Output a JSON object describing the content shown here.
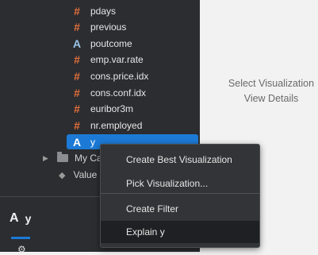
{
  "fields": [
    {
      "name": "pdays",
      "type": "numeric",
      "icon": "hash-icon"
    },
    {
      "name": "previous",
      "type": "numeric",
      "icon": "hash-icon"
    },
    {
      "name": "poutcome",
      "type": "string",
      "icon": "string-a-icon"
    },
    {
      "name": "emp.var.rate",
      "type": "numeric",
      "icon": "hash-icon"
    },
    {
      "name": "cons.price.idx",
      "type": "numeric",
      "icon": "hash-icon"
    },
    {
      "name": "cons.conf.idx",
      "type": "numeric",
      "icon": "hash-icon"
    },
    {
      "name": "euribor3m",
      "type": "numeric",
      "icon": "hash-icon"
    },
    {
      "name": "nr.employed",
      "type": "numeric",
      "icon": "hash-icon"
    },
    {
      "name": "y",
      "type": "string",
      "icon": "string-a-icon",
      "selected": true
    }
  ],
  "tree": {
    "my_calcs_label": "My Ca",
    "value_label": "Value"
  },
  "detail": {
    "field_icon_glyph": "A",
    "field_name": "y"
  },
  "hint": {
    "line1": "Select Visualization",
    "line2": "View Details"
  },
  "context_menu": {
    "items": [
      {
        "label": "Create Best Visualization"
      },
      {
        "label": "Pick Visualization..."
      },
      {
        "label": "Create Filter"
      },
      {
        "label": "Explain y"
      }
    ]
  },
  "colors": {
    "sidebar_bg": "#2b2d30",
    "selected_bg": "#1c7ad6",
    "numeric_icon": "#e5703d",
    "string_icon": "#9bc3e8"
  }
}
